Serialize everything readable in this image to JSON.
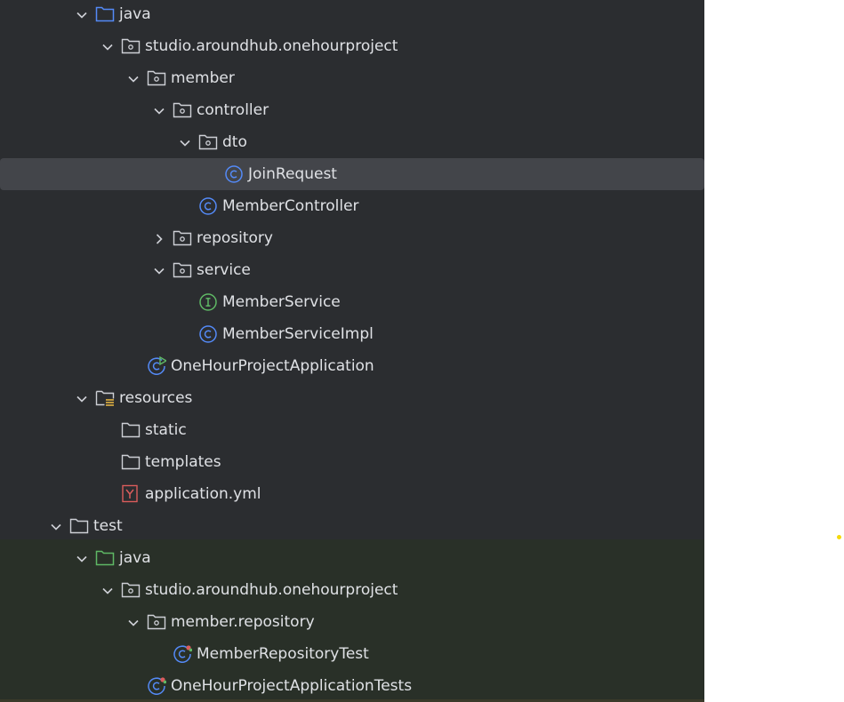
{
  "project_tree": {
    "items": [
      {
        "id": "java-main",
        "label": "java",
        "depth": 3,
        "expander": "down",
        "icon": "source-folder-icon"
      },
      {
        "id": "pkg-main",
        "label": "studio.aroundhub.onehourproject",
        "depth": 4,
        "expander": "down",
        "icon": "package-icon"
      },
      {
        "id": "pkg-member",
        "label": "member",
        "depth": 5,
        "expander": "down",
        "icon": "package-icon"
      },
      {
        "id": "pkg-controller",
        "label": "controller",
        "depth": 6,
        "expander": "down",
        "icon": "package-icon"
      },
      {
        "id": "pkg-dto",
        "label": "dto",
        "depth": 7,
        "expander": "down",
        "icon": "package-icon"
      },
      {
        "id": "class-joinrequest",
        "label": "JoinRequest",
        "depth": 8,
        "expander": "none",
        "icon": "class-icon",
        "selected": true
      },
      {
        "id": "class-membercontroller",
        "label": "MemberController",
        "depth": 7,
        "expander": "none",
        "icon": "class-icon"
      },
      {
        "id": "pkg-repository",
        "label": "repository",
        "depth": 6,
        "expander": "right",
        "icon": "package-icon"
      },
      {
        "id": "pkg-service",
        "label": "service",
        "depth": 6,
        "expander": "down",
        "icon": "package-icon"
      },
      {
        "id": "iface-memberservice",
        "label": "MemberService",
        "depth": 7,
        "expander": "none",
        "icon": "interface-icon"
      },
      {
        "id": "class-memberserviceimpl",
        "label": "MemberServiceImpl",
        "depth": 7,
        "expander": "none",
        "icon": "class-icon"
      },
      {
        "id": "class-app",
        "label": "OneHourProjectApplication",
        "depth": 5,
        "expander": "none",
        "icon": "spring-boot-class-icon"
      },
      {
        "id": "resources",
        "label": "resources",
        "depth": 3,
        "expander": "down",
        "icon": "resources-folder-icon"
      },
      {
        "id": "static",
        "label": "static",
        "depth": 4,
        "expander": "none",
        "icon": "folder-icon"
      },
      {
        "id": "templates",
        "label": "templates",
        "depth": 4,
        "expander": "none",
        "icon": "folder-icon"
      },
      {
        "id": "application-yml",
        "label": "application.yml",
        "depth": 4,
        "expander": "none",
        "icon": "yaml-file-icon"
      },
      {
        "id": "test",
        "label": "test",
        "depth": 2,
        "expander": "down",
        "icon": "folder-icon"
      },
      {
        "id": "java-test",
        "label": "java",
        "depth": 3,
        "expander": "down",
        "icon": "test-source-folder-icon"
      },
      {
        "id": "pkg-test",
        "label": "studio.aroundhub.onehourproject",
        "depth": 4,
        "expander": "down",
        "icon": "package-icon"
      },
      {
        "id": "pkg-member-repository",
        "label": "member.repository",
        "depth": 5,
        "expander": "down",
        "icon": "package-icon"
      },
      {
        "id": "class-memberrepositorytest",
        "label": "MemberRepositoryTest",
        "depth": 6,
        "expander": "none",
        "icon": "test-class-icon"
      },
      {
        "id": "class-apptests",
        "label": "OneHourProjectApplicationTests",
        "depth": 5,
        "expander": "none",
        "icon": "test-class-icon"
      }
    ]
  },
  "colors": {
    "panel_bg": "#2b2d30",
    "test_bg": "#293028",
    "selected_bg": "#43454a",
    "text": "#dfe1e5",
    "class_icon": "#548af7",
    "interface_icon": "#5fb865",
    "yaml_icon": "#db5c5c"
  }
}
